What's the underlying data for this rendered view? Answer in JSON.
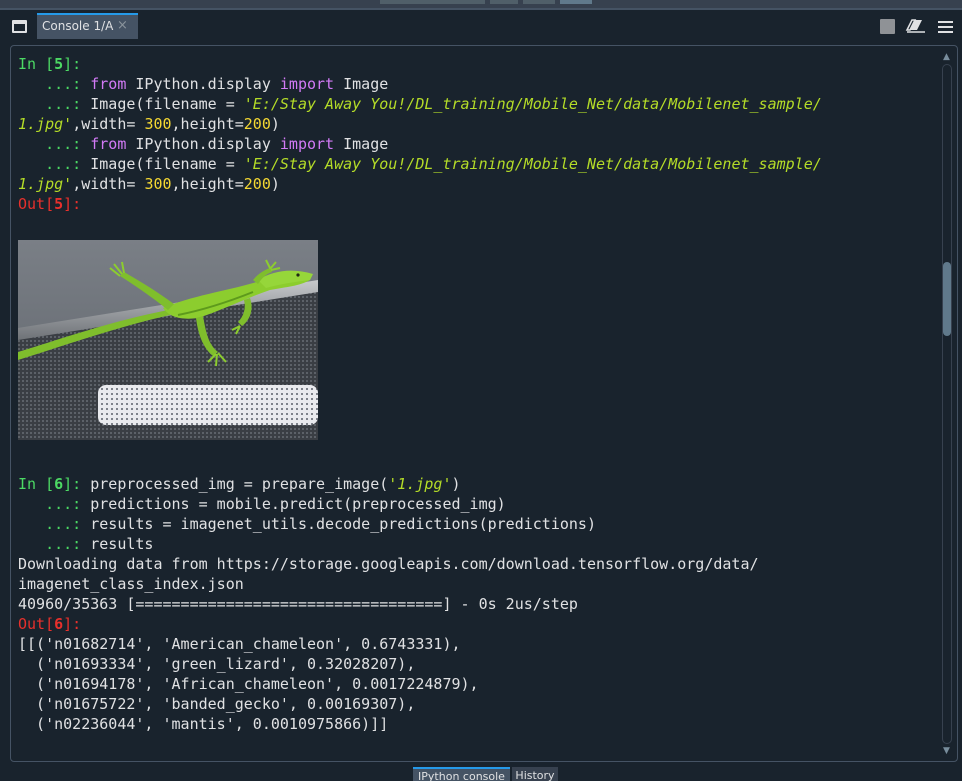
{
  "tab_bar": {
    "console_tab_label": "Console 1/A",
    "close_glyph": "×"
  },
  "icons": {
    "browse_tabs": "browse-tabs-icon",
    "close_tab": "close-icon",
    "interrupt": "stop-icon",
    "clear_console": "eraser-icon",
    "options_menu": "hamburger-menu-icon"
  },
  "console": {
    "cell5": {
      "in_prompt": "In [",
      "in_number": "5",
      "in_suffix": "]:",
      "cont_prompt": "   ...: ",
      "line1_kw1": "from",
      "line1_mod": " IPython.display ",
      "line1_kw2": "import",
      "line1_name": " Image",
      "line2_a": "Image(filename = ",
      "line2_str": "'E:/Stay Away You!/DL_training/Mobile_Net/data/Mobilenet_sample/",
      "line3_str": "1.jpg'",
      "line3_a": ",width= ",
      "line3_w": "300",
      "line3_b": ",height=",
      "line3_h": "200",
      "line3_c": ")",
      "out_prompt": "Out[",
      "out_number": "5",
      "out_suffix": "]:"
    },
    "cell6": {
      "in_prompt": "In [",
      "in_number": "6",
      "in_suffix": "]: ",
      "cont_prompt": "   ...: ",
      "line1_a": "preprocessed_img = prepare_image(",
      "line1_str": "'1.jpg'",
      "line1_b": ")",
      "line2": "predictions = mobile.predict(preprocessed_img)",
      "line3": "results = imagenet_utils.decode_predictions(predictions)",
      "line4": "results",
      "download_line1": "Downloading data from https://storage.googleapis.com/download.tensorflow.org/data/",
      "download_line2": "imagenet_class_index.json",
      "progress_line": "40960/35363 [==================================] - 0s 2us/step",
      "out_prompt": "Out[",
      "out_number": "6",
      "out_suffix": "]:",
      "result_lines": [
        "[[('n01682714', 'American_chameleon', 0.6743331),",
        "  ('n01693334', 'green_lizard', 0.32028207),",
        "  ('n01694178', 'African_chameleon', 0.0017224879),",
        "  ('n01675722', 'banded_gecko', 0.00169307),",
        "  ('n02236044', 'mantis', 0.0010975866)]]"
      ]
    }
  },
  "bottom_tabs": {
    "ipython": "IPython console",
    "history": "History"
  },
  "colors": {
    "background": "#19232d",
    "prompt_in": "#4cd964",
    "prompt_out": "#e8302c",
    "keyword": "#d27af6",
    "string": "#b4dc28",
    "number": "#f5d833",
    "accent": "#259ae9"
  }
}
